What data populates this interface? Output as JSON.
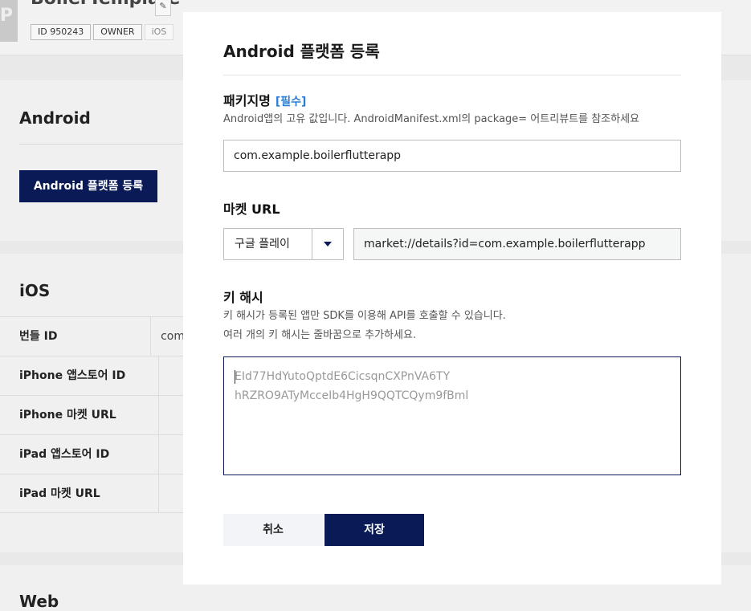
{
  "background": {
    "app_icon_letter": "P",
    "app_title": "BoilerTemplate",
    "edit_icon": "edit-icon",
    "tags": [
      "ID 950243",
      "OWNER",
      "iOS"
    ],
    "android": {
      "heading": "Android",
      "register_button": "Android 플랫폼 등록"
    },
    "ios": {
      "heading": "iOS",
      "rows": [
        {
          "label": "번들 ID",
          "value": "com"
        },
        {
          "label": "iPhone 앱스토어 ID",
          "value": ""
        },
        {
          "label": "iPhone 마켓 URL",
          "value": ""
        },
        {
          "label": "iPad 앱스토어 ID",
          "value": ""
        },
        {
          "label": "iPad 마켓 URL",
          "value": ""
        }
      ]
    },
    "web": {
      "heading": "Web"
    }
  },
  "modal": {
    "title": "Android 플랫폼 등록",
    "package": {
      "label": "패키지명",
      "required": "[필수]",
      "description": "Android앱의 고유 값입니다. AndroidManifest.xml의 package= 어트리뷰트를 참조하세요",
      "value": "com.example.boilerflutterapp"
    },
    "market": {
      "label": "마켓 URL",
      "store_selected": "구글 플레이",
      "url_value": "market://details?id=com.example.boilerflutterapp"
    },
    "key_hash": {
      "label": "키 해시",
      "description_line1": "키 해시가 등록된 앱만 SDK를 이용해 API를 호출할 수 있습니다.",
      "description_line2": "여러 개의 키 해시는 줄바꿈으로 추가하세요.",
      "placeholder_line1": "EId77HdYutoQptdE6CicsqnCXPnVA6TY",
      "placeholder_line2": "hRZRO9ATyMcceIb4HgH9QQTCQym9fBml"
    },
    "buttons": {
      "cancel": "취소",
      "save": "저장"
    }
  },
  "colors": {
    "primary": "#0a1a56",
    "required": "#2a7fd4",
    "overlay": "#e9e9e9"
  }
}
